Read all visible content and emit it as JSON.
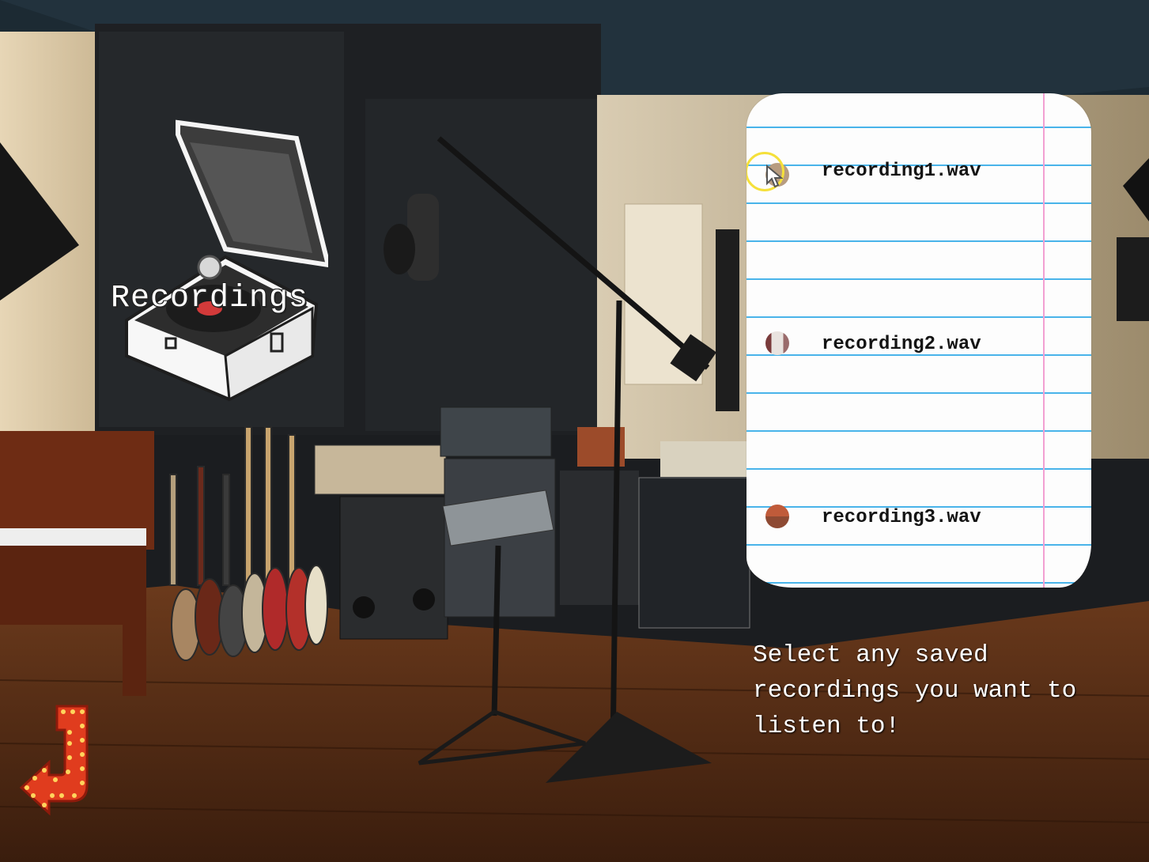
{
  "screen_title": "Recordings",
  "recordings": [
    {
      "filename": "recording1.wav",
      "dot_color": "#b79c80"
    },
    {
      "filename": "recording2.wav",
      "dot_color": "#c7b3ad"
    },
    {
      "filename": "recording3.wav",
      "dot_color": "#b35a3c"
    }
  ],
  "instruction": "Select any saved recordings you want to listen to!",
  "colors": {
    "paper": "#fdfdfd",
    "paper_lines": "#49b4ea",
    "paper_margin": "#f2a0d2",
    "back_arrow": "#e03c1e",
    "cursor_ring": "#f5e03a"
  },
  "icons": {
    "record_player": "record-player-icon",
    "back": "back-arrow-icon",
    "cursor": "mouse-cursor-icon"
  }
}
